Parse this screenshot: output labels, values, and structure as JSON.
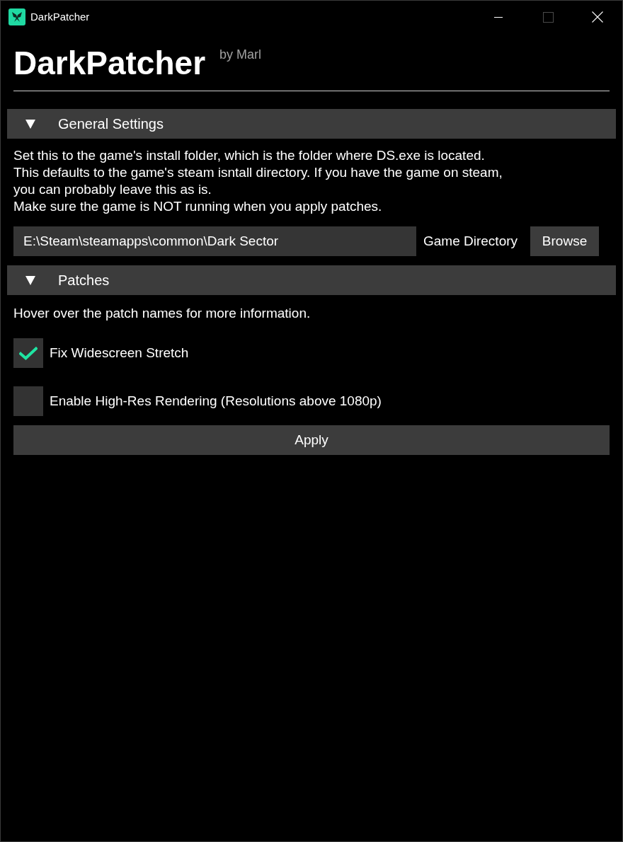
{
  "window": {
    "title": "DarkPatcher",
    "maximize": {
      "disabled": true
    }
  },
  "header": {
    "title": "DarkPatcher",
    "byline": "by Marl"
  },
  "general_settings": {
    "title": "General Settings",
    "expanded": true,
    "description": [
      "Set this to the game's install folder, which is the folder where DS.exe is located.",
      "This defaults to the game's steam isntall directory. If you have the game on steam,",
      "you can probably leave this as is.",
      "Make sure the game is NOT running when you apply patches."
    ],
    "directory_field": {
      "value": "E:\\Steam\\steamapps\\common\\Dark Sector",
      "label": "Game Directory"
    },
    "browse_button": "Browse"
  },
  "patches": {
    "title": "Patches",
    "expanded": true,
    "hint": "Hover over the patch names for more information.",
    "items": [
      {
        "label": "Fix Widescreen Stretch",
        "checked": true
      },
      {
        "label": "Enable High-Res Rendering (Resolutions above 1080p)",
        "checked": false
      }
    ],
    "apply_button": "Apply"
  }
}
